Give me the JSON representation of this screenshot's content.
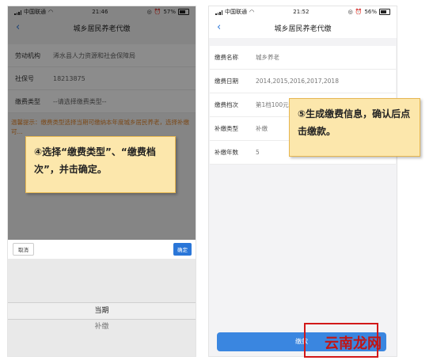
{
  "left_screen": {
    "status": {
      "carrier": "中国联通",
      "time": "21:46",
      "battery": "57%"
    },
    "title": "城乡居民养老代缴",
    "form": [
      {
        "label": "劳动机构",
        "value": "浠水县人力资源和社会保障局"
      },
      {
        "label": "社保号",
        "value": "18213875"
      },
      {
        "label": "缴费类型",
        "value": "--请选择缴费类型--"
      }
    ],
    "warning": "温馨提示：缴费类型选择当期可缴纳本年度城乡居民养老，选择补缴可...",
    "picker": {
      "cancel_label": "取消",
      "confirm_label": "确定",
      "selected": "当期",
      "next": "补缴"
    },
    "callout": "④选择“缴费类型”、“缴费档次”，并击确定。"
  },
  "right_screen": {
    "status": {
      "carrier": "中国联通",
      "time": "21:52",
      "battery": "56%"
    },
    "title": "城乡居民养老代缴",
    "form": [
      {
        "label": "缴费名称",
        "value": "城乡养老"
      },
      {
        "label": "缴费日期",
        "value": "2014,2015,2016,2017,2018"
      },
      {
        "label": "缴费档次",
        "value": "第1档100元"
      },
      {
        "label": "补缴类型",
        "value": "补缴"
      },
      {
        "label": "补缴年数",
        "value": "5"
      }
    ],
    "pay_label": "缴款",
    "callout": "⑤生成缴费信息，确认后点击缴款。"
  },
  "watermark": "云南龙网"
}
